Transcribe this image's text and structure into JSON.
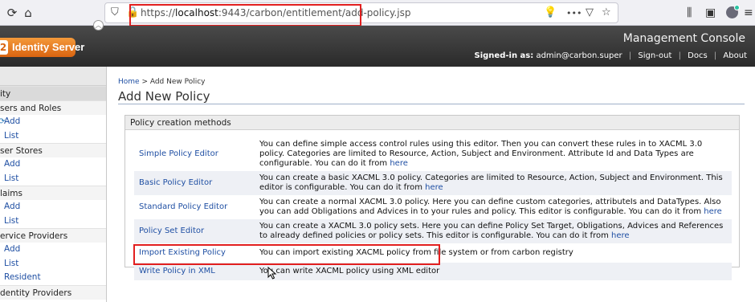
{
  "browser": {
    "url_scheme": "https://",
    "url_host": "localhost",
    "url_rest": ":9443/carbon/entitlement/add-policy.jsp",
    "menu_dots": "•••"
  },
  "header": {
    "logo_number": "2",
    "logo_text": "Identity Server",
    "console_title": "Management Console",
    "signed_in_label": "Signed-in as:",
    "signed_in_user": "admin@carbon.super",
    "signout": "Sign-out",
    "docs": "Docs",
    "about": "About"
  },
  "sidebar": {
    "top_label": "ity",
    "sections": [
      {
        "label": "sers and Roles",
        "items": [
          "Add",
          "List"
        ]
      },
      {
        "label": "ser Stores",
        "items": [
          "Add",
          "List"
        ]
      },
      {
        "label": "laims",
        "items": [
          "Add",
          "List"
        ]
      },
      {
        "label": "ervice Providers",
        "items": [
          "Add",
          "List",
          "Resident"
        ]
      },
      {
        "label": "dentity Providers",
        "items": []
      }
    ]
  },
  "main": {
    "breadcrumb_home": "Home",
    "breadcrumb_sep": " > ",
    "breadcrumb_current": "Add New Policy",
    "title": "Add New Policy",
    "box_title": "Policy creation methods",
    "methods": [
      {
        "name": "Simple Policy Editor",
        "desc": "You can define simple access control rules using this editor. Then you can convert these rules in to XACML 3.0 policy. Categories are limited to Resource, Action, Subject and Environment. Attribute Id and Data Types are configurable. You can do it from ",
        "link": "here"
      },
      {
        "name": "Basic Policy Editor",
        "desc": "You can create a basic XACML 3.0 policy. Categories are limited to Resource, Action, Subject and Environment. This editor is configurable. You can do it from ",
        "link": "here"
      },
      {
        "name": "Standard Policy Editor",
        "desc": "You can create a normal XACML 3.0 policy. Here you can define custom categories, attributeIs and DataTypes. Also you can add Obligations and Advices in to your rules and policy. This editor is configurable. You can do it from ",
        "link": "here"
      },
      {
        "name": "Policy Set Editor",
        "desc": "You can create a XACML 3.0 policy sets. Here you can define Policy Set Target, Obligations, Advices and References to already defined policies or policy sets. This editor is configurable. You can do it from ",
        "link": "here"
      },
      {
        "name": "Import Existing Policy",
        "desc": "You can import existing XACML policy from file system or from carbon registry",
        "link": ""
      },
      {
        "name": "Write Policy in XML",
        "desc": "You can write XACML policy using XML editor",
        "link": ""
      }
    ]
  },
  "colors": {
    "link": "#1f4fa3",
    "highlight_box": "#e21f1f",
    "logo_orange": "#d96411"
  }
}
